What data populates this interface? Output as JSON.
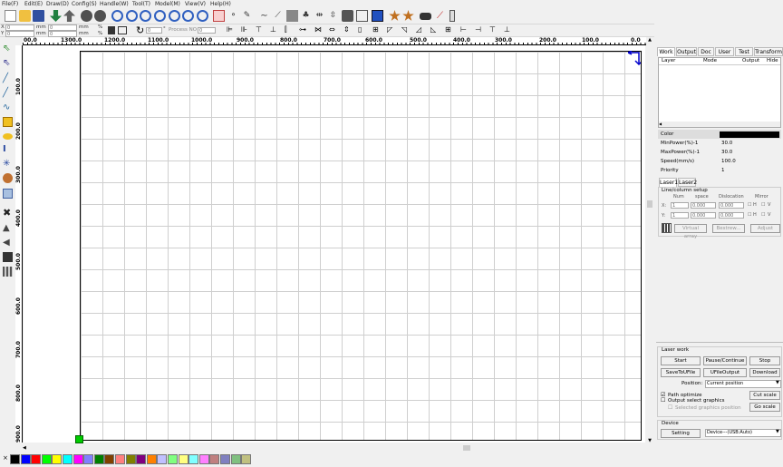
{
  "menu": [
    "File(F)",
    "Edit(E)",
    "Draw(D)",
    "Config(S)",
    "Handle(W)",
    "Tool(T)",
    "Model(M)",
    "View(V)",
    "Help(H)"
  ],
  "toolbar2": {
    "x_value": "0",
    "y_value": "0",
    "w_value": "0",
    "h_value": "0",
    "unit_mm": "mm",
    "unit_pct": "%",
    "x_label": "X",
    "y_label": "Y",
    "rotate_value": "0",
    "degree": "°",
    "process_no_label": "Process NO",
    "process_no_value": "0"
  },
  "hruler_labels": [
    "00.0",
    "1300.0",
    "1200.0",
    "1100.0",
    "1000.0",
    "900.0",
    "800.0",
    "700.0",
    "600.0",
    "500.0",
    "400.0",
    "300.0",
    "200.0",
    "100.0",
    "0.0"
  ],
  "vruler_labels": [
    "100.0",
    "200.0",
    "300.0",
    "400.0",
    "500.0",
    "600.0",
    "700.0",
    "800.0",
    "900.0"
  ],
  "palette": [
    "#000000",
    "#0000ff",
    "#ff0000",
    "#00ff00",
    "#ffff00",
    "#00ffff",
    "#ff00ff",
    "#8080ff",
    "#008000",
    "#804000",
    "#ff8080",
    "#808000",
    "#800080",
    "#ff8000",
    "#c0c0ff",
    "#80ff80",
    "#ffff80",
    "#80ffff",
    "#ff80ff",
    "#c08080",
    "#8080c0",
    "#80c080",
    "#c0c080"
  ],
  "panel": {
    "tabs": [
      "Work",
      "Output",
      "Doc",
      "User",
      "Test",
      "Transform"
    ],
    "layer_headers": [
      "Layer",
      "Mode",
      "Output",
      "Hide"
    ],
    "props": [
      {
        "key": "Color",
        "value": ""
      },
      {
        "key": "MinPower(%)-1",
        "value": "30.0"
      },
      {
        "key": "MaxPower(%)-1",
        "value": "30.0"
      },
      {
        "key": "Speed(mm/s)",
        "value": "100.0"
      },
      {
        "key": "Priority",
        "value": "1"
      }
    ],
    "laser_tabs": [
      "Laser1",
      "Laser2"
    ],
    "line_col_title": "Line/column setup",
    "lc_headers": [
      "Num",
      "space",
      "Dislocation",
      "Mirror"
    ],
    "lc_x_label": "X:",
    "lc_y_label": "Y:",
    "lc_x": {
      "num": "1",
      "space": "0.000",
      "disloc": "0.000"
    },
    "lc_y": {
      "num": "1",
      "space": "0.000",
      "disloc": "0.000"
    },
    "mirror_h": "H",
    "mirror_v": "V",
    "lc_buttons": [
      "Virtual array",
      "Bestrew...",
      "Adjust"
    ],
    "laser_work_title": "Laser work",
    "work_buttons": [
      "Start",
      "Pause/Continue",
      "Stop",
      "SaveToUFile",
      "UFileOutput",
      "Download"
    ],
    "position_label": "Position:",
    "position_value": "Current position",
    "path_optimize": "Path optimize",
    "output_select": "Output select graphics",
    "selected_pos": "Selected graphics position",
    "cut_scale": "Cut scale",
    "go_scale": "Go scale",
    "device_title": "Device",
    "setting_btn": "Setting",
    "device_value": "Device---(USB:Auto)"
  },
  "colors": {
    "accent": "#0000cc",
    "grid": "#c8c8c8",
    "origin_green": "#00cc00"
  }
}
